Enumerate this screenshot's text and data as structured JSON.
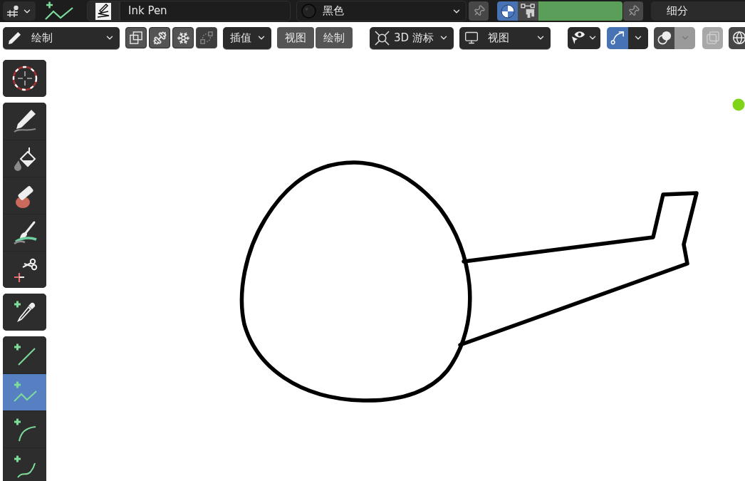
{
  "top_bar": {
    "brush": {
      "name": "Ink Pen"
    },
    "material": {
      "name": "黑色"
    },
    "color_modes": [
      {
        "kind": "material",
        "selected": true
      },
      {
        "kind": "vertex",
        "selected": false
      }
    ],
    "vertex_color": {
      "color": "#5a9e5a"
    },
    "subdivide": {
      "label": "细分"
    }
  },
  "tool_header": {
    "mode": {
      "label": "绘制"
    },
    "icon_buttons": [
      {
        "kind": "copy",
        "disabled": false
      },
      {
        "kind": "weight",
        "disabled": false
      },
      {
        "kind": "freeze",
        "disabled": false
      },
      {
        "kind": "link",
        "disabled": true
      }
    ],
    "interpolate": {
      "label": "插值"
    },
    "menus": [
      {
        "label": "视图"
      },
      {
        "label": "绘制"
      }
    ],
    "cursor": {
      "label": "3D 游标"
    },
    "view": {
      "label": "视图"
    },
    "snapping": {
      "on": true
    },
    "overlay": {
      "caret_disabled": true
    },
    "layers": {
      "disabled": true
    }
  },
  "toolbar": {
    "groups": [
      {
        "tools": [
          {
            "kind": "cursor",
            "selected": false
          }
        ]
      },
      {
        "tools": [
          {
            "kind": "draw",
            "selected": false
          },
          {
            "kind": "fill",
            "selected": false
          },
          {
            "kind": "erase",
            "selected": false
          },
          {
            "kind": "tint",
            "selected": false
          },
          {
            "kind": "cutter",
            "selected": false
          }
        ]
      },
      {
        "tools": [
          {
            "kind": "eyedropper",
            "selected": false
          }
        ]
      },
      {
        "tools": [
          {
            "kind": "line",
            "selected": false
          },
          {
            "kind": "polyline",
            "selected": true
          },
          {
            "kind": "arc",
            "selected": false
          },
          {
            "kind": "curve",
            "selected": false
          }
        ]
      }
    ]
  }
}
